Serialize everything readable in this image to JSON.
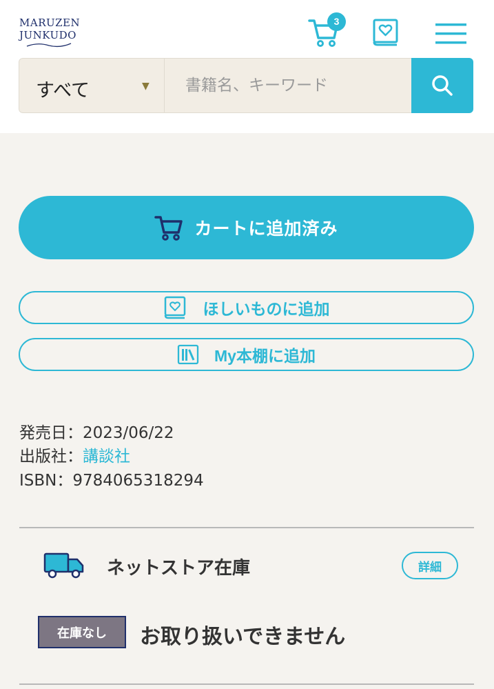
{
  "header": {
    "logo_line1": "MARUZEN",
    "logo_line2": "JUNKUDO",
    "cart_count": "3",
    "cart_icon": "cart-icon",
    "wishlist_icon": "wishlist-book-icon",
    "menu_icon": "hamburger-menu-icon"
  },
  "search": {
    "category": "すべて",
    "placeholder": "書籍名、キーワード",
    "button_icon": "search-icon"
  },
  "actions": {
    "cart_label": "カートに追加済み",
    "wish_label": "ほしいものに追加",
    "shelf_label": "My本棚に追加"
  },
  "product": {
    "release_label": "発売日：",
    "release_value": "2023/06/22",
    "publisher_label": "出版社：",
    "publisher_value": "講談社",
    "isbn_label": "ISBN：",
    "isbn_value": "9784065318294"
  },
  "stock": {
    "title": "ネットストア在庫",
    "detail_label": "詳細",
    "badge": "在庫なし",
    "message": "お取り扱いできません"
  },
  "colors": {
    "accent": "#2db8d5",
    "navy": "#1f2f6b",
    "background": "#f5f3ef",
    "badge_gray": "#7d7683"
  }
}
